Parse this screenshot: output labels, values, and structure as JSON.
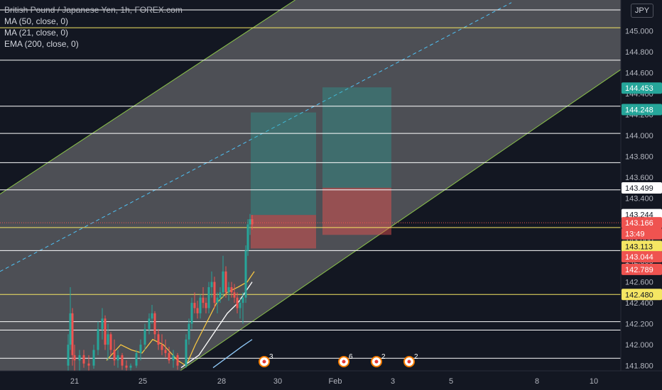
{
  "legend": {
    "title": "British Pound / Japanese Yen, 1h, FOREX.com",
    "ma50": "MA (50, close, 0)",
    "ma21": "MA (21, close, 0)",
    "ema200": "EMA (200, close, 0)"
  },
  "currency": "JPY",
  "colors": {
    "background": "#131722",
    "up": "#26a69a",
    "down": "#ef5350",
    "channel": "#8bc34a",
    "yellow": "#f5e663",
    "white": "#ffffff",
    "tp": "#26a69a",
    "sl": "#ef5350"
  },
  "chart_data": {
    "type": "candlestick",
    "x_ticks": [
      "21",
      "25",
      "28",
      "30",
      "Feb",
      "3",
      "5",
      "8",
      "10"
    ],
    "y_ticks": [
      145.0,
      144.8,
      144.6,
      144.4,
      144.2,
      144.0,
      143.8,
      143.6,
      143.4,
      143.2,
      143.0,
      142.8,
      142.6,
      142.4,
      142.2,
      142.0,
      141.8
    ],
    "ylim": [
      141.75,
      145.2
    ],
    "price_labels": [
      {
        "text": "144.453",
        "value": 144.453,
        "color": "#26a69a"
      },
      {
        "text": "144.248",
        "value": 144.248,
        "color": "#26a69a"
      },
      {
        "text": "143.499",
        "value": 143.499,
        "color": "#ffffff"
      },
      {
        "text": "143.244",
        "value": 143.244,
        "color": "#ffffff"
      },
      {
        "text": "143.166",
        "value": 143.166,
        "color": "#ef5350"
      },
      {
        "text": "13:49",
        "value": 143.06,
        "color": "#ef5350"
      },
      {
        "text": "143.113",
        "value": 142.94,
        "color": "#f5e663"
      },
      {
        "text": "143.044",
        "value": 142.84,
        "color": "#ef5350"
      },
      {
        "text": "142.789",
        "value": 142.72,
        "color": "#ef5350"
      },
      {
        "text": "142.480",
        "value": 142.48,
        "color": "#f5e663"
      }
    ],
    "horizontal_levels": [
      {
        "value": 145.2,
        "color": "white"
      },
      {
        "value": 145.03,
        "color": "yellow"
      },
      {
        "value": 144.72,
        "color": "white"
      },
      {
        "value": 144.28,
        "color": "white"
      },
      {
        "value": 144.02,
        "color": "white"
      },
      {
        "value": 143.74,
        "color": "white"
      },
      {
        "value": 143.48,
        "color": "white"
      },
      {
        "value": 143.12,
        "color": "yellow"
      },
      {
        "value": 142.9,
        "color": "white"
      },
      {
        "value": 142.48,
        "color": "yellow"
      },
      {
        "value": 142.22,
        "color": "white"
      },
      {
        "value": 142.14,
        "color": "white"
      },
      {
        "value": 141.87,
        "color": "white"
      }
    ],
    "channel": {
      "upper": [
        [
          0,
          143.44
        ],
        [
          410,
          145.27
        ]
      ],
      "mid": [
        [
          0,
          142.7
        ],
        [
          720,
          145.27
        ]
      ],
      "lower": [
        [
          260,
          141.78
        ],
        [
          872,
          144.62
        ]
      ]
    },
    "positions": [
      {
        "x0": 353,
        "x1": 445,
        "entry": 143.24,
        "target": 144.22,
        "stop": 142.92
      },
      {
        "x0": 454,
        "x1": 551,
        "entry": 143.5,
        "target": 144.46,
        "stop": 143.05
      }
    ],
    "candles": [
      [
        96,
        141.8,
        142.1,
        141.75,
        142.0
      ],
      [
        99,
        142.0,
        142.55,
        141.95,
        142.3
      ],
      [
        102,
        142.3,
        142.35,
        141.8,
        141.9
      ],
      [
        105,
        141.9,
        142.0,
        141.75,
        141.85
      ],
      [
        112,
        141.85,
        141.95,
        141.75,
        141.9
      ],
      [
        118,
        141.9,
        141.95,
        141.78,
        141.82
      ],
      [
        125,
        141.82,
        141.9,
        141.75,
        141.8
      ],
      [
        132,
        141.8,
        142.0,
        141.77,
        141.95
      ],
      [
        138,
        141.95,
        142.22,
        141.9,
        142.15
      ],
      [
        144,
        142.15,
        142.35,
        142.05,
        142.25
      ],
      [
        148,
        142.25,
        142.28,
        141.95,
        142.0
      ],
      [
        152,
        142.0,
        142.2,
        141.85,
        142.1
      ],
      [
        156,
        142.1,
        142.12,
        141.9,
        141.95
      ],
      [
        161,
        141.95,
        142.05,
        141.8,
        141.85
      ],
      [
        166,
        141.85,
        141.95,
        141.78,
        141.9
      ],
      [
        172,
        141.9,
        141.92,
        141.76,
        141.8
      ],
      [
        178,
        141.8,
        141.85,
        141.75,
        141.78
      ],
      [
        184,
        141.78,
        141.82,
        141.75,
        141.8
      ],
      [
        192,
        141.8,
        141.95,
        141.78,
        141.92
      ],
      [
        198,
        141.92,
        142.05,
        141.85,
        142.0
      ],
      [
        204,
        142.0,
        142.2,
        141.95,
        142.15
      ],
      [
        210,
        142.15,
        142.3,
        142.1,
        142.25
      ],
      [
        214,
        142.25,
        142.38,
        142.2,
        142.3
      ],
      [
        218,
        142.3,
        142.32,
        142.05,
        142.1
      ],
      [
        223,
        142.1,
        142.15,
        141.95,
        142.0
      ],
      [
        228,
        142.0,
        142.1,
        141.9,
        141.95
      ],
      [
        233,
        141.95,
        142.05,
        141.88,
        141.92
      ],
      [
        238,
        141.92,
        141.98,
        141.82,
        141.85
      ],
      [
        244,
        141.85,
        141.95,
        141.78,
        141.9
      ],
      [
        250,
        141.9,
        141.92,
        141.76,
        141.8
      ],
      [
        262,
        141.8,
        142.1,
        141.78,
        142.05
      ],
      [
        266,
        142.05,
        142.25,
        142.0,
        142.2
      ],
      [
        270,
        142.2,
        142.45,
        142.15,
        142.4
      ],
      [
        274,
        142.4,
        142.5,
        142.3,
        142.35
      ],
      [
        278,
        142.35,
        142.42,
        142.25,
        142.3
      ],
      [
        282,
        142.3,
        142.48,
        142.25,
        142.45
      ],
      [
        286,
        142.45,
        142.55,
        142.35,
        142.4
      ],
      [
        290,
        142.4,
        142.45,
        142.3,
        142.35
      ],
      [
        294,
        142.35,
        142.6,
        142.3,
        142.55
      ],
      [
        298,
        142.55,
        142.7,
        142.45,
        142.6
      ],
      [
        302,
        142.6,
        142.65,
        142.35,
        142.4
      ],
      [
        306,
        142.4,
        142.5,
        142.3,
        142.45
      ],
      [
        310,
        142.45,
        142.55,
        142.4,
        142.5
      ],
      [
        314,
        142.5,
        142.85,
        142.45,
        142.7
      ],
      [
        318,
        142.7,
        142.75,
        142.45,
        142.5
      ],
      [
        322,
        142.5,
        142.6,
        142.42,
        142.55
      ],
      [
        326,
        142.55,
        142.6,
        142.45,
        142.5
      ],
      [
        330,
        142.5,
        142.58,
        142.4,
        142.45
      ],
      [
        334,
        142.45,
        142.5,
        142.3,
        142.35
      ],
      [
        338,
        142.35,
        142.45,
        142.25,
        142.4
      ],
      [
        342,
        142.4,
        142.5,
        142.2,
        142.45
      ],
      [
        346,
        142.45,
        142.95,
        142.4,
        142.9
      ],
      [
        349,
        142.9,
        143.2,
        142.85,
        143.15
      ],
      [
        352,
        143.15,
        143.25,
        143.05,
        143.2
      ],
      [
        355,
        143.2,
        143.24,
        143.1,
        143.15
      ]
    ],
    "ma_fast": [
      [
        150,
        141.85
      ],
      [
        170,
        142.0
      ],
      [
        185,
        141.95
      ],
      [
        200,
        141.92
      ],
      [
        215,
        142.05
      ],
      [
        230,
        142.0
      ],
      [
        250,
        141.85
      ],
      [
        262,
        141.8
      ],
      [
        275,
        142.0
      ],
      [
        290,
        142.2
      ],
      [
        305,
        142.4
      ],
      [
        320,
        142.5
      ],
      [
        335,
        142.55
      ],
      [
        348,
        142.6
      ],
      [
        358,
        142.7
      ]
    ],
    "ma_slow": [
      [
        255,
        141.78
      ],
      [
        280,
        141.9
      ],
      [
        300,
        142.1
      ],
      [
        320,
        142.3
      ],
      [
        335,
        142.4
      ],
      [
        345,
        142.5
      ],
      [
        355,
        142.6
      ]
    ],
    "ema_long": [
      [
        300,
        141.78
      ],
      [
        320,
        141.88
      ],
      [
        340,
        141.98
      ],
      [
        355,
        142.05
      ]
    ],
    "event_markers": [
      {
        "x": 372,
        "label": "3"
      },
      {
        "x": 484,
        "label": "6"
      },
      {
        "x": 530,
        "label": "2"
      },
      {
        "x": 576,
        "label": "2"
      }
    ]
  }
}
